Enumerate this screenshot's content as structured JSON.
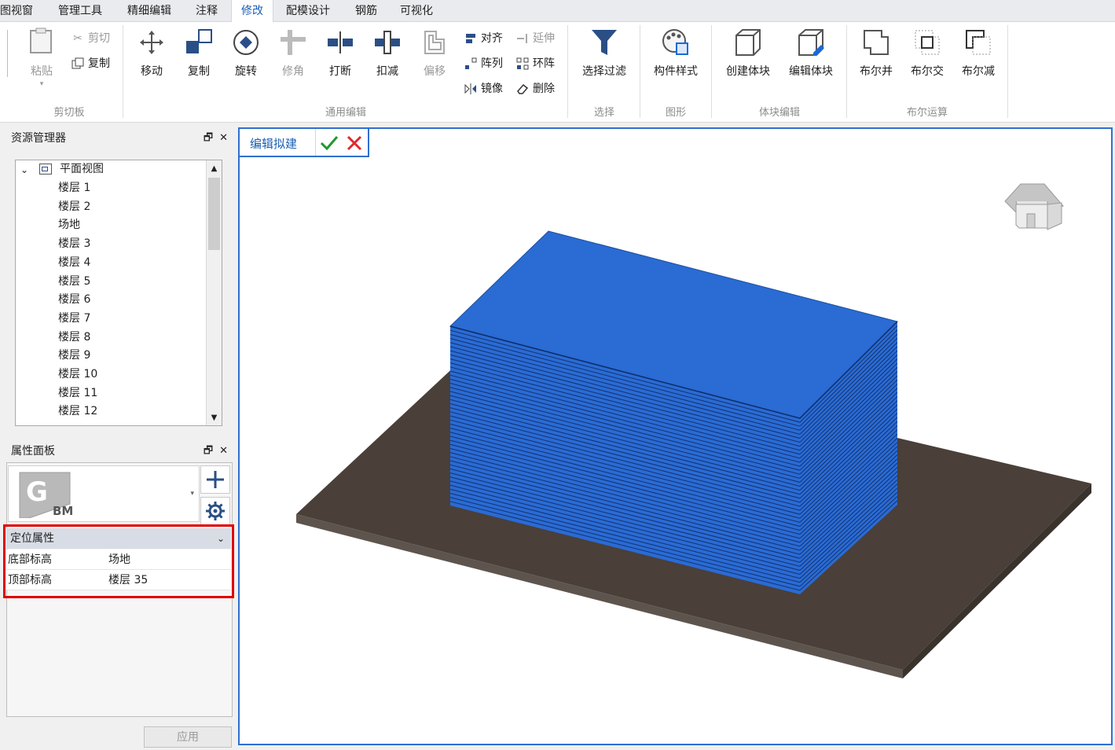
{
  "menu": {
    "tabs": [
      "图视窗",
      "管理工具",
      "精细编辑",
      "注释",
      "修改",
      "配模设计",
      "钢筋",
      "可视化"
    ],
    "active_tab": "修改"
  },
  "ribbon": {
    "clipboard": {
      "paste": "粘贴",
      "cut": "剪切",
      "copy": "复制",
      "label": "剪切板"
    },
    "general_edit": {
      "move": "移动",
      "duplicate": "复制",
      "rotate": "旋转",
      "trim": "修角",
      "break": "打断",
      "deduct": "扣减",
      "offset": "偏移",
      "align": "对齐",
      "extend": "延伸",
      "array": "阵列",
      "ring_array": "环阵",
      "mirror": "镜像",
      "delete": "删除",
      "label": "通用编辑"
    },
    "select": {
      "filter": "选择过滤",
      "label": "选择"
    },
    "graphics": {
      "component_style": "构件样式",
      "label": "图形"
    },
    "block_edit": {
      "create_block": "创建体块",
      "edit_block": "编辑体块",
      "label": "体块编辑"
    },
    "boolean": {
      "union": "布尔并",
      "intersect": "布尔交",
      "subtract": "布尔减",
      "label": "布尔运算"
    }
  },
  "resource_manager": {
    "title": "资源管理器",
    "root": "平面视图",
    "items": [
      "楼层 1",
      "楼层 2",
      "场地",
      "楼层 3",
      "楼层 4",
      "楼层 5",
      "楼层 6",
      "楼层 7",
      "楼层 8",
      "楼层 9",
      "楼层 10",
      "楼层 11",
      "楼层 12"
    ]
  },
  "property_panel": {
    "title": "属性面板",
    "logo_letters": "GBM",
    "section": "定位属性",
    "rows": [
      {
        "key": "底部标高",
        "value": "场地"
      },
      {
        "key": "顶部标高",
        "value": "楼层 35"
      }
    ],
    "apply": "应用"
  },
  "viewport": {
    "edit_mode_label": "编辑拟建",
    "colors": {
      "block": "#2a6bd4",
      "ground": "#4a3f39",
      "accent": "#2f6fd0",
      "highlight": "#e00000"
    }
  }
}
